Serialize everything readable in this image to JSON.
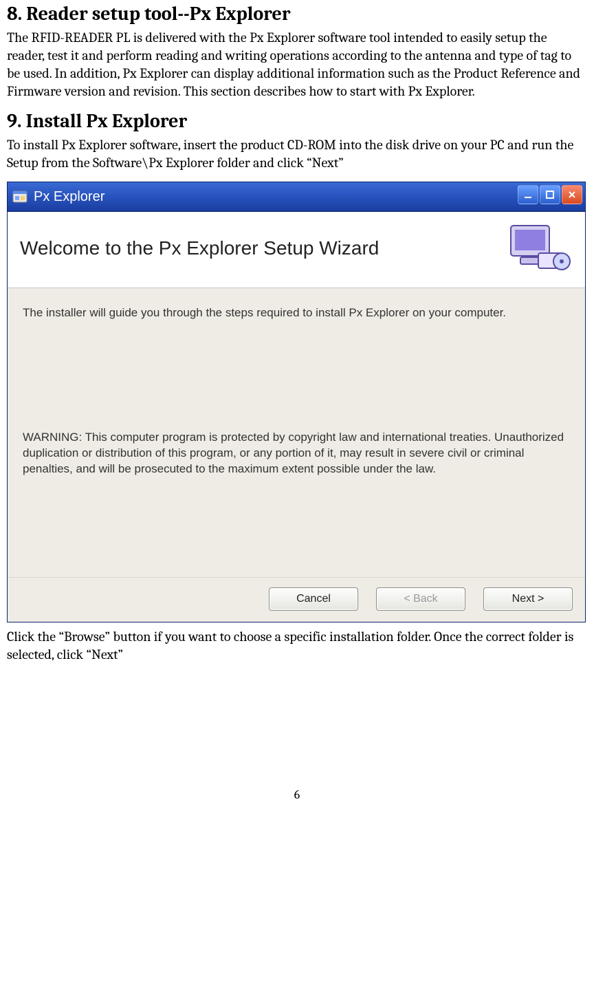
{
  "sections": {
    "s8": {
      "heading": "8. Reader setup tool--Px Explorer",
      "body": "The RFID-READER PL is delivered with the Px Explorer software tool intended to easily setup the reader, test it and perform reading and writing operations according to the antenna and type of tag to be used. In addition, Px Explorer can display additional information such as the Product Reference and Firmware version and revision. This section describes how to start with Px Explorer."
    },
    "s9": {
      "heading": "9. Install Px Explorer",
      "body": "To install Px Explorer software, insert the product CD-ROM into the disk drive on your PC and run the Setup from the Software\\Px Explorer folder and click “Next”"
    },
    "after_img": "Click the “Browse” button if you want to choose a specific installation folder. Once the correct folder is selected, click “Next”"
  },
  "installer": {
    "title": "Px Explorer",
    "banner_title": "Welcome to the Px Explorer Setup Wizard",
    "intro": "The installer will guide you through the steps required to install Px Explorer on your computer.",
    "warning": "WARNING: This computer program is protected by copyright law and international treaties. Unauthorized duplication or distribution of this program, or any portion of it, may result in severe civil or criminal penalties, and will be prosecuted to the maximum extent possible under the law.",
    "buttons": {
      "cancel": "Cancel",
      "back": "< Back",
      "next": "Next >"
    }
  },
  "page_number": "6"
}
